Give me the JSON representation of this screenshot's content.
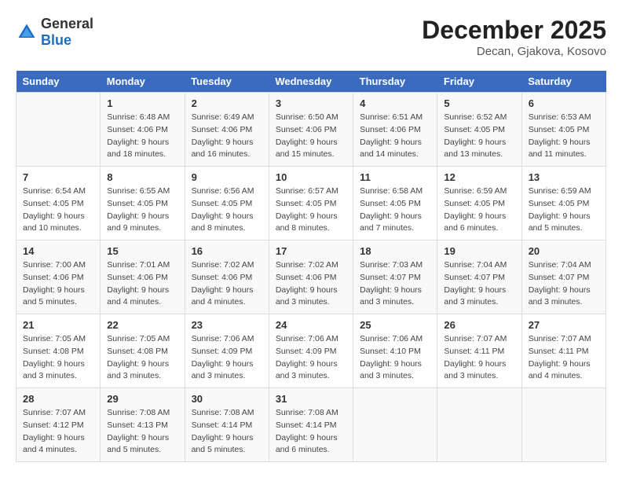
{
  "header": {
    "logo": {
      "general": "General",
      "blue": "Blue"
    },
    "title": "December 2025",
    "location": "Decan, Gjakova, Kosovo"
  },
  "weekdays": [
    "Sunday",
    "Monday",
    "Tuesday",
    "Wednesday",
    "Thursday",
    "Friday",
    "Saturday"
  ],
  "weeks": [
    [
      {
        "day": "",
        "info": ""
      },
      {
        "day": "1",
        "info": "Sunrise: 6:48 AM\nSunset: 4:06 PM\nDaylight: 9 hours\nand 18 minutes."
      },
      {
        "day": "2",
        "info": "Sunrise: 6:49 AM\nSunset: 4:06 PM\nDaylight: 9 hours\nand 16 minutes."
      },
      {
        "day": "3",
        "info": "Sunrise: 6:50 AM\nSunset: 4:06 PM\nDaylight: 9 hours\nand 15 minutes."
      },
      {
        "day": "4",
        "info": "Sunrise: 6:51 AM\nSunset: 4:06 PM\nDaylight: 9 hours\nand 14 minutes."
      },
      {
        "day": "5",
        "info": "Sunrise: 6:52 AM\nSunset: 4:05 PM\nDaylight: 9 hours\nand 13 minutes."
      },
      {
        "day": "6",
        "info": "Sunrise: 6:53 AM\nSunset: 4:05 PM\nDaylight: 9 hours\nand 11 minutes."
      }
    ],
    [
      {
        "day": "7",
        "info": "Sunrise: 6:54 AM\nSunset: 4:05 PM\nDaylight: 9 hours\nand 10 minutes."
      },
      {
        "day": "8",
        "info": "Sunrise: 6:55 AM\nSunset: 4:05 PM\nDaylight: 9 hours\nand 9 minutes."
      },
      {
        "day": "9",
        "info": "Sunrise: 6:56 AM\nSunset: 4:05 PM\nDaylight: 9 hours\nand 8 minutes."
      },
      {
        "day": "10",
        "info": "Sunrise: 6:57 AM\nSunset: 4:05 PM\nDaylight: 9 hours\nand 8 minutes."
      },
      {
        "day": "11",
        "info": "Sunrise: 6:58 AM\nSunset: 4:05 PM\nDaylight: 9 hours\nand 7 minutes."
      },
      {
        "day": "12",
        "info": "Sunrise: 6:59 AM\nSunset: 4:05 PM\nDaylight: 9 hours\nand 6 minutes."
      },
      {
        "day": "13",
        "info": "Sunrise: 6:59 AM\nSunset: 4:05 PM\nDaylight: 9 hours\nand 5 minutes."
      }
    ],
    [
      {
        "day": "14",
        "info": "Sunrise: 7:00 AM\nSunset: 4:06 PM\nDaylight: 9 hours\nand 5 minutes."
      },
      {
        "day": "15",
        "info": "Sunrise: 7:01 AM\nSunset: 4:06 PM\nDaylight: 9 hours\nand 4 minutes."
      },
      {
        "day": "16",
        "info": "Sunrise: 7:02 AM\nSunset: 4:06 PM\nDaylight: 9 hours\nand 4 minutes."
      },
      {
        "day": "17",
        "info": "Sunrise: 7:02 AM\nSunset: 4:06 PM\nDaylight: 9 hours\nand 3 minutes."
      },
      {
        "day": "18",
        "info": "Sunrise: 7:03 AM\nSunset: 4:07 PM\nDaylight: 9 hours\nand 3 minutes."
      },
      {
        "day": "19",
        "info": "Sunrise: 7:04 AM\nSunset: 4:07 PM\nDaylight: 9 hours\nand 3 minutes."
      },
      {
        "day": "20",
        "info": "Sunrise: 7:04 AM\nSunset: 4:07 PM\nDaylight: 9 hours\nand 3 minutes."
      }
    ],
    [
      {
        "day": "21",
        "info": "Sunrise: 7:05 AM\nSunset: 4:08 PM\nDaylight: 9 hours\nand 3 minutes."
      },
      {
        "day": "22",
        "info": "Sunrise: 7:05 AM\nSunset: 4:08 PM\nDaylight: 9 hours\nand 3 minutes."
      },
      {
        "day": "23",
        "info": "Sunrise: 7:06 AM\nSunset: 4:09 PM\nDaylight: 9 hours\nand 3 minutes."
      },
      {
        "day": "24",
        "info": "Sunrise: 7:06 AM\nSunset: 4:09 PM\nDaylight: 9 hours\nand 3 minutes."
      },
      {
        "day": "25",
        "info": "Sunrise: 7:06 AM\nSunset: 4:10 PM\nDaylight: 9 hours\nand 3 minutes."
      },
      {
        "day": "26",
        "info": "Sunrise: 7:07 AM\nSunset: 4:11 PM\nDaylight: 9 hours\nand 3 minutes."
      },
      {
        "day": "27",
        "info": "Sunrise: 7:07 AM\nSunset: 4:11 PM\nDaylight: 9 hours\nand 4 minutes."
      }
    ],
    [
      {
        "day": "28",
        "info": "Sunrise: 7:07 AM\nSunset: 4:12 PM\nDaylight: 9 hours\nand 4 minutes."
      },
      {
        "day": "29",
        "info": "Sunrise: 7:08 AM\nSunset: 4:13 PM\nDaylight: 9 hours\nand 5 minutes."
      },
      {
        "day": "30",
        "info": "Sunrise: 7:08 AM\nSunset: 4:14 PM\nDaylight: 9 hours\nand 5 minutes."
      },
      {
        "day": "31",
        "info": "Sunrise: 7:08 AM\nSunset: 4:14 PM\nDaylight: 9 hours\nand 6 minutes."
      },
      {
        "day": "",
        "info": ""
      },
      {
        "day": "",
        "info": ""
      },
      {
        "day": "",
        "info": ""
      }
    ]
  ]
}
